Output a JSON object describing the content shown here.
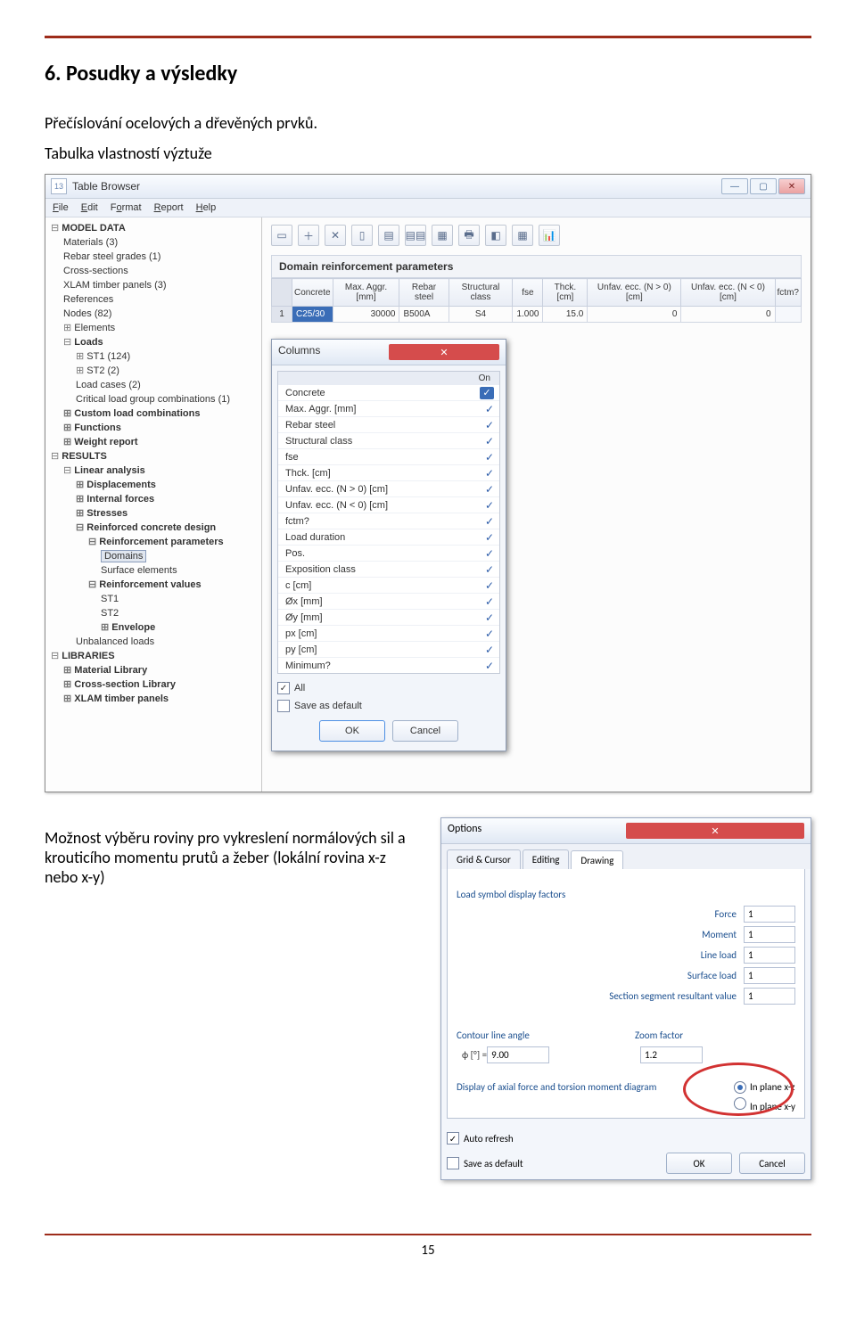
{
  "doc": {
    "section_title": "6. Posudky a výsledky",
    "p1": "Přečíslování ocelových a dřevěných prvků.",
    "p2": "Tabulka vlastností výztuže",
    "p3": "Možnost výběru roviny pro vykreslení normálových sil a krouticího momentu prutů a žeber (lokální rovina x-z nebo x-y)",
    "page_num": "15"
  },
  "tablebrowser": {
    "icon_text": "13",
    "title": "Table Browser",
    "winbuttons": {
      "min": "—",
      "max": "▢",
      "close": "✕"
    },
    "menu": {
      "file": "File",
      "edit": "Edit",
      "format": "Format",
      "report": "Report",
      "help": "Help"
    },
    "toolbar_glyphs": [
      "▭",
      "＋",
      "✕",
      "▯",
      "▤",
      "▤▤",
      "▦",
      "🖶",
      "◧",
      "▦",
      "📊"
    ],
    "panel_title": "Domain reinforcement parameters",
    "headers": [
      "Concrete",
      "Max.\nAggr. [mm]",
      "Rebar steel",
      "Structural\nclass",
      "fse",
      "Thck.\n[cm]",
      "Unfav. ecc.\n(N > 0)  [cm]",
      "Unfav. ecc.\n(N < 0)  [cm]",
      "fctm?"
    ],
    "row": [
      "C25/30",
      "30000",
      "B500A",
      "S4",
      "1.000",
      "15.0",
      "0",
      "0",
      ""
    ],
    "rownum": "1"
  },
  "tree": {
    "model_data": "MODEL DATA",
    "materials": "Materials (3)",
    "rebar": "Rebar steel grades (1)",
    "cross": "Cross-sections",
    "xlam": "XLAM timber panels (3)",
    "refs": "References",
    "nodes": "Nodes (82)",
    "elements": "Elements",
    "loads": "Loads",
    "st1": "ST1 (124)",
    "st2": "ST2 (2)",
    "loadcases": "Load cases (2)",
    "crit": "Critical load group combinations (1)",
    "custom": "Custom load combinations",
    "functions": "Functions",
    "weight": "Weight report",
    "results": "RESULTS",
    "linear": "Linear analysis",
    "disp": "Displacements",
    "iforces": "Internal forces",
    "stresses": "Stresses",
    "rcdesign": "Reinforced concrete design",
    "rparams": "Reinforcement parameters",
    "domains": "Domains",
    "surfel": "Surface elements",
    "rvalues": "Reinforcement values",
    "rst1": "ST1",
    "rst2": "ST2",
    "envelope": "Envelope",
    "unbal": "Unbalanced loads",
    "libraries": "LIBRARIES",
    "matlib": "Material Library",
    "cslib": "Cross-section Library",
    "xlamlib": "XLAM timber panels"
  },
  "columns": {
    "title": "Columns",
    "close": "✕",
    "on": "On",
    "items": [
      "Concrete",
      "Max. Aggr. [mm]",
      "Rebar steel",
      "Structural class",
      "fse",
      "Thck.  [cm]",
      "Unfav. ecc. (N > 0)  [cm]",
      "Unfav. ecc. (N < 0)  [cm]",
      "fctm?",
      "Load duration",
      "Pos.",
      "Exposition class",
      "c  [cm]",
      "Øx  [mm]",
      "Øy  [mm]",
      "px  [cm]",
      "py  [cm]",
      "Minimum?"
    ],
    "all": "All",
    "save": "Save as default",
    "ok": "OK",
    "cancel": "Cancel"
  },
  "options": {
    "title": "Options",
    "close": "✕",
    "tabs": {
      "grid": "Grid & Cursor",
      "editing": "Editing",
      "drawing": "Drawing"
    },
    "load_factors": "Load symbol display factors",
    "force": "Force",
    "moment": "Moment",
    "lineload": "Line load",
    "surfload": "Surface load",
    "section": "Section segment resultant value",
    "vforce": "1",
    "vmoment": "1",
    "vline": "1",
    "vsurf": "1",
    "vsection": "1",
    "contour_title": "Contour line angle",
    "contour_label": "ϕ [°] =  ",
    "contour_val": "9.00",
    "zoom_title": "Zoom factor",
    "zoom_val": "1.2",
    "plane_label": "Display of axial force and torsion moment diagram",
    "plane_xz": "In plane x-z",
    "plane_xy": "In plane x-y",
    "auto": "Auto refresh",
    "savedef": "Save as default",
    "ok": "OK",
    "cancel": "Cancel"
  }
}
